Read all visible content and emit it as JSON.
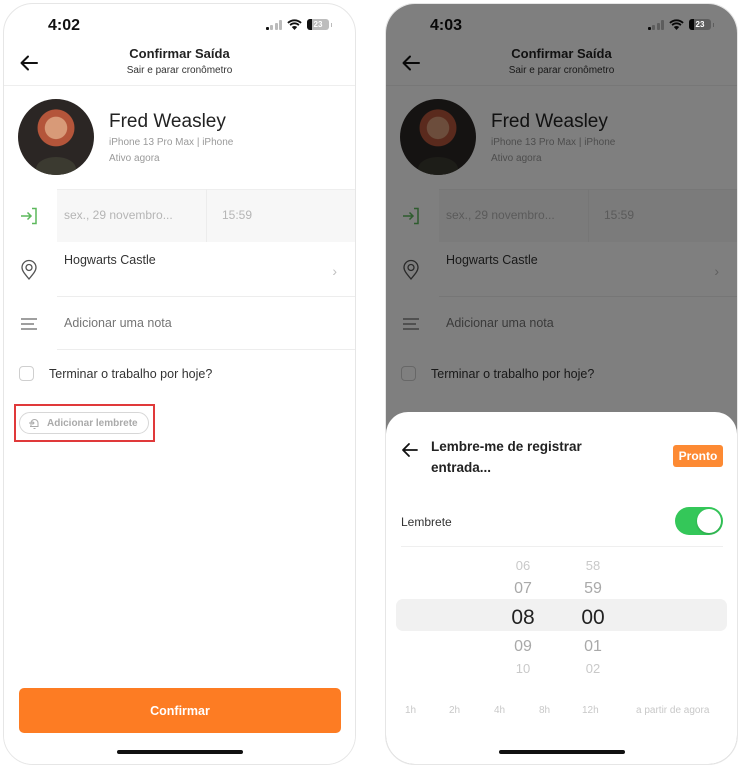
{
  "left_screen": {
    "status_bar": {
      "time": "4:02",
      "battery": "23"
    },
    "header": {
      "title": "Confirmar Saída",
      "subtitle": "Sair e parar cronômetro",
      "back_icon": "arrow-left-icon"
    },
    "profile": {
      "name": "Fred Weasley",
      "device": "iPhone 13 Pro Max | iPhone",
      "status": "Ativo agora"
    },
    "clock_out": {
      "icon": "clock-in-icon",
      "date": "sex., 29 novembro...",
      "time": "15:59",
      "icon_color": "#5cb85c"
    },
    "location": {
      "icon": "location-pin-icon",
      "name": "Hogwarts Castle",
      "chevron": "chevron-right-icon"
    },
    "note": {
      "icon": "note-lines-icon",
      "placeholder": "Adicionar uma nota"
    },
    "end_day": {
      "label": "Terminar o trabalho por hoje?",
      "checked": false
    },
    "reminder_button": {
      "label": "Adicionar lembrete",
      "icon": "reminder-bell-icon",
      "highlight_color": "#e0393a"
    },
    "confirm_button": {
      "label": "Confirmar",
      "color": "#fd7c23"
    }
  },
  "right_screen": {
    "status_bar": {
      "time": "4:03",
      "battery": "23"
    },
    "header": {
      "title": "Confirmar Saída",
      "subtitle": "Sair e parar cronômetro"
    },
    "profile": {
      "name": "Fred Weasley",
      "device": "iPhone 13 Pro Max | iPhone",
      "status": "Ativo agora"
    },
    "clock_out": {
      "date": "sex., 29 novembro...",
      "time": "15:59"
    },
    "location": {
      "name": "Hogwarts Castle"
    },
    "note": {
      "placeholder": "Adicionar uma nota"
    },
    "end_day": {
      "label": "Terminar o trabalho por hoje?"
    },
    "sheet": {
      "title": "Lembre-me de registrar entrada...",
      "done_label": "Pronto",
      "done_color": "#fd8a33",
      "toggle_label": "Lembrete",
      "toggle_on": true,
      "toggle_color": "#34c759",
      "picker": {
        "hours": [
          "06",
          "07",
          "08",
          "09",
          "10"
        ],
        "minutes": [
          "58",
          "59",
          "00",
          "01",
          "02"
        ],
        "selected_hour": "08",
        "selected_minute": "00"
      },
      "quick_options": [
        "1h",
        "2h",
        "4h",
        "8h",
        "12h",
        "a partir de agora"
      ]
    }
  }
}
